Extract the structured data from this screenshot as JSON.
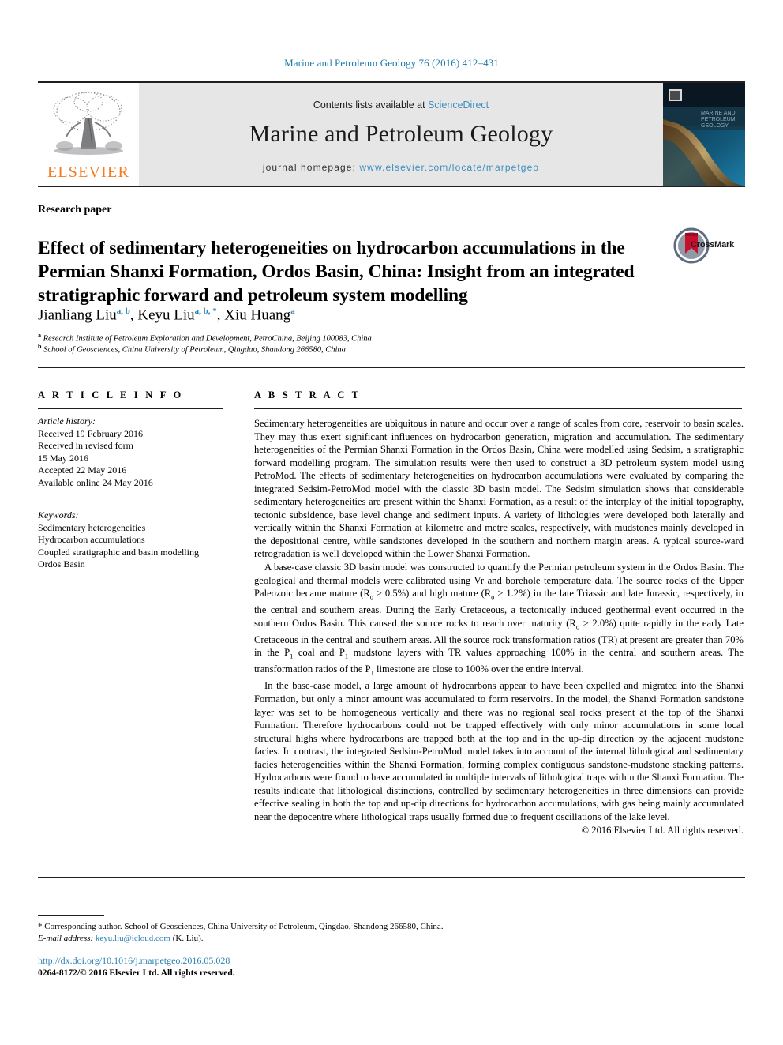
{
  "running_head": "Marine and Petroleum Geology 76 (2016) 412–431",
  "masthead": {
    "publisher_logo_text": "ELSEVIER",
    "contents_prefix": "Contents lists available at ",
    "contents_link": "ScienceDirect",
    "journal_title": "Marine and Petroleum Geology",
    "homepage_prefix": "journal homepage: ",
    "homepage_url": "www.elsevier.com/locate/marpetgeo"
  },
  "article": {
    "type": "Research paper",
    "title": "Effect of sedimentary heterogeneities on hydrocarbon accumulations in the Permian Shanxi Formation, Ordos Basin, China: Insight from an integrated stratigraphic forward and petroleum system modelling",
    "crossmark_label": "CrossMark",
    "authors_plain": "Jianliang Liu a, b, Keyu Liu a, b, *, Xiu Huang a",
    "authors": [
      {
        "name": "Jianliang Liu",
        "marks": "a, b"
      },
      {
        "name": "Keyu Liu",
        "marks": "a, b, *"
      },
      {
        "name": "Xiu Huang",
        "marks": "a"
      }
    ],
    "affiliations": [
      {
        "mark": "a",
        "text": "Research Institute of Petroleum Exploration and Development, PetroChina, Beijing 100083, China"
      },
      {
        "mark": "b",
        "text": "School of Geosciences, China University of Petroleum, Qingdao, Shandong 266580, China"
      }
    ]
  },
  "article_info": {
    "heading": "A R T I C L E  I N F O",
    "history_label": "Article history:",
    "history": [
      "Received 19 February 2016",
      "Received in revised form",
      "15 May 2016",
      "Accepted 22 May 2016",
      "Available online 24 May 2016"
    ],
    "keywords_label": "Keywords:",
    "keywords": [
      "Sedimentary heterogeneities",
      "Hydrocarbon accumulations",
      "Coupled stratigraphic and basin modelling",
      "Ordos Basin"
    ]
  },
  "abstract": {
    "heading": "A B S T R A C T",
    "paragraphs": [
      "Sedimentary heterogeneities are ubiquitous in nature and occur over a range of scales from core, reservoir to basin scales. They may thus exert significant influences on hydrocarbon generation, migration and accumulation. The sedimentary heterogeneities of the Permian Shanxi Formation in the Ordos Basin, China were modelled using Sedsim, a stratigraphic forward modelling program. The simulation results were then used to construct a 3D petroleum system model using PetroMod. The effects of sedimentary heterogeneities on hydrocarbon accumulations were evaluated by comparing the integrated Sedsim-PetroMod model with the classic 3D basin model. The Sedsim simulation shows that considerable sedimentary heterogeneities are present within the Shanxi Formation, as a result of the interplay of the initial topography, tectonic subsidence, base level change and sediment inputs. A variety of lithologies were developed both laterally and vertically within the Shanxi Formation at kilometre and metre scales, respectively, with mudstones mainly developed in the depositional centre, while sandstones developed in the southern and northern margin areas. A typical source-ward retrogradation is well developed within the Lower Shanxi Formation.",
      "A base-case classic 3D basin model was constructed to quantify the Permian petroleum system in the Ordos Basin. The geological and thermal models were calibrated using Vr and borehole temperature data. The source rocks of the Upper Paleozoic became mature (Ro > 0.5%) and high mature (Ro > 1.2%) in the late Triassic and late Jurassic, respectively, in the central and southern areas. During the Early Cretaceous, a tectonically induced geothermal event occurred in the southern Ordos Basin. This caused the source rocks to reach over maturity (Ro > 2.0%) quite rapidly in the early Late Cretaceous in the central and southern areas. All the source rock transformation ratios (TR) at present are greater than 70% in the P1 coal and P1 mudstone layers with TR values approaching 100% in the central and southern areas. The transformation ratios of the P1 limestone are close to 100% over the entire interval.",
      "In the base-case model, a large amount of hydrocarbons appear to have been expelled and migrated into the Shanxi Formation, but only a minor amount was accumulated to form reservoirs. In the model, the Shanxi Formation sandstone layer was set to be homogeneous vertically and there was no regional seal rocks present at the top of the Shanxi Formation. Therefore hydrocarbons could not be trapped effectively with only minor accumulations in some local structural highs where hydrocarbons are trapped both at the top and in the up-dip direction by the adjacent mudstone facies. In contrast, the integrated Sedsim-PetroMod model takes into account of the internal lithological and sedimentary facies heterogeneities within the Shanxi Formation, forming complex contiguous sandstone-mudstone stacking patterns. Hydrocarbons were found to have accumulated in multiple intervals of lithological traps within the Shanxi Formation. The results indicate that lithological distinctions, controlled by sedimentary heterogeneities in three dimensions can provide effective sealing in both the top and up-dip directions for hydrocarbon accumulations, with gas being mainly accumulated near the depocentre where lithological traps usually formed due to frequent oscillations of the lake level."
    ],
    "copyright": "© 2016 Elsevier Ltd. All rights reserved."
  },
  "footnote": {
    "marker": "*",
    "corresponding": "Corresponding author. School of Geosciences, China University of Petroleum, Qingdao, Shandong 266580, China.",
    "email_label": "E-mail address:",
    "email": "keyu.liu@icloud.com",
    "email_owner": "(K. Liu)."
  },
  "footer": {
    "doi": "http://dx.doi.org/10.1016/j.marpetgeo.2016.05.028",
    "issn_line": "0264-8172/© 2016 Elsevier Ltd. All rights reserved."
  },
  "colors": {
    "link": "#2c82b5",
    "elsevier_orange": "#f47b20",
    "band_gray": "#e6e6e6",
    "crossmark_red": "#c8102e"
  }
}
